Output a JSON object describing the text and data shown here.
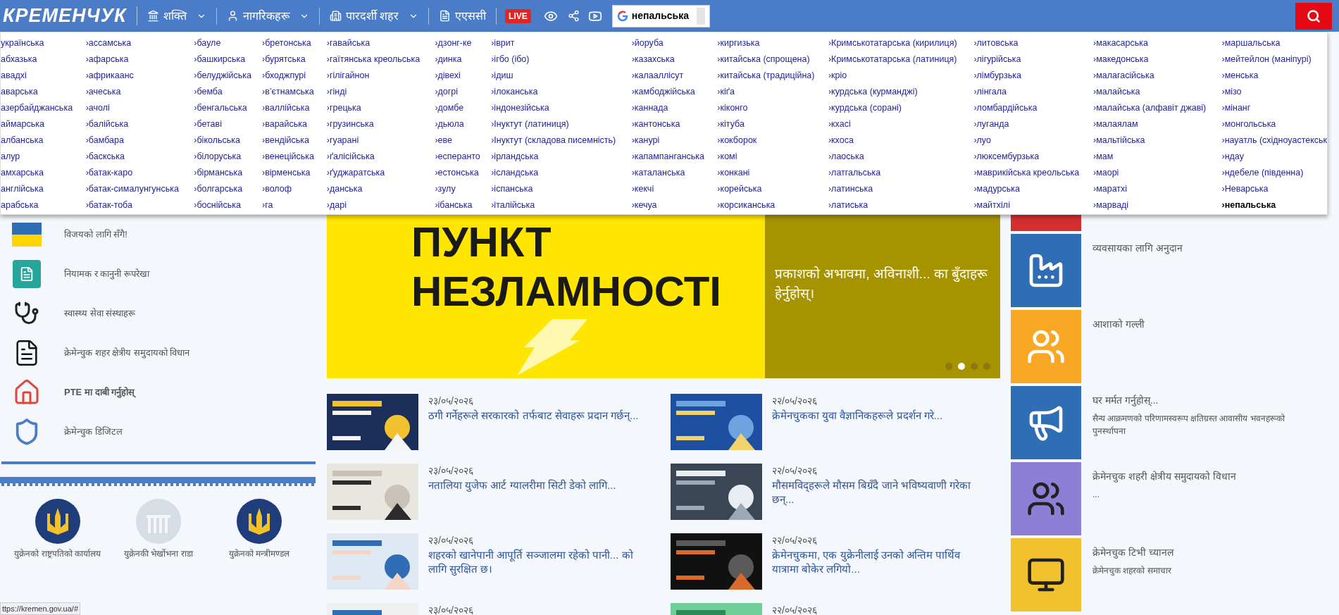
{
  "header": {
    "logo": "КРЕМЕНЧУК",
    "nav": [
      {
        "label": "शक्ति",
        "dropdown": true
      },
      {
        "label": "नागरिकहरू",
        "dropdown": true
      },
      {
        "label": "पारदर्शी शहर",
        "dropdown": true
      },
      {
        "label": "एएससी",
        "dropdown": false
      }
    ],
    "live_badge": "LIVE",
    "translate_value": "непальська"
  },
  "language_menu": {
    "columns": [
      [
        {
          "label": "українська",
          "selected": false
        },
        {
          "label": "абхазька",
          "selected": false
        },
        {
          "label": "авадхі",
          "selected": false
        },
        {
          "label": "аварська",
          "selected": false
        },
        {
          "label": "азербайджанська",
          "selected": false
        },
        {
          "label": "аймарська",
          "selected": false
        },
        {
          "label": "албанська",
          "selected": false
        },
        {
          "label": "алур",
          "selected": false
        },
        {
          "label": "амхарська",
          "selected": false
        },
        {
          "label": "англійська",
          "selected": false
        },
        {
          "label": "арабська",
          "selected": false
        }
      ],
      [
        {
          "label": "›ассамська",
          "selected": false
        },
        {
          "label": "›афарська",
          "selected": false
        },
        {
          "label": "›африкаанс",
          "selected": false
        },
        {
          "label": "›ачеська",
          "selected": false
        },
        {
          "label": "›ачолі",
          "selected": false
        },
        {
          "label": "›балійська",
          "selected": false
        },
        {
          "label": "›бамбара",
          "selected": false
        },
        {
          "label": "›баскська",
          "selected": false
        },
        {
          "label": "›батак-каро",
          "selected": false
        },
        {
          "label": "›батак-сималунгунська",
          "selected": false
        },
        {
          "label": "›батак-тоба",
          "selected": false
        }
      ],
      [
        {
          "label": "›бауле",
          "selected": false
        },
        {
          "label": "›башкирська",
          "selected": false
        },
        {
          "label": "›белуджійська",
          "selected": false
        },
        {
          "label": "›бемба",
          "selected": false
        },
        {
          "label": "›бенгальська",
          "selected": false
        },
        {
          "label": "›бетаві",
          "selected": false
        },
        {
          "label": "›бікольська",
          "selected": false
        },
        {
          "label": "›білоруська",
          "selected": false
        },
        {
          "label": "›бірманська",
          "selected": false
        },
        {
          "label": "›болгарська",
          "selected": false
        },
        {
          "label": "›боснійська",
          "selected": false
        }
      ],
      [
        {
          "label": "›бретонська",
          "selected": false
        },
        {
          "label": "›бурятська",
          "selected": false
        },
        {
          "label": "›бходжпурі",
          "selected": false
        },
        {
          "label": "›в’єтнамська",
          "selected": false
        },
        {
          "label": "›валлійська",
          "selected": false
        },
        {
          "label": "›варайська",
          "selected": false
        },
        {
          "label": "›вендійська",
          "selected": false
        },
        {
          "label": "›венеційська",
          "selected": false
        },
        {
          "label": "›вірменська",
          "selected": false
        },
        {
          "label": "›волоф",
          "selected": false
        },
        {
          "label": "›га",
          "selected": false
        }
      ],
      [
        {
          "label": "›гавайська",
          "selected": false
        },
        {
          "label": "›гаїтянська креольська",
          "selected": false
        },
        {
          "label": "›гілігайнон",
          "selected": false
        },
        {
          "label": "›гінді",
          "selected": false
        },
        {
          "label": "›грецька",
          "selected": false
        },
        {
          "label": "›грузинська",
          "selected": false
        },
        {
          "label": "›гуарані",
          "selected": false
        },
        {
          "label": "›ґалісійська",
          "selected": false
        },
        {
          "label": "›ґуджаратська",
          "selected": false
        },
        {
          "label": "›данська",
          "selected": false
        },
        {
          "label": "›дарі",
          "selected": false
        }
      ],
      [
        {
          "label": "›дзонг-ке",
          "selected": false
        },
        {
          "label": "›динка",
          "selected": false
        },
        {
          "label": "›дівехі",
          "selected": false
        },
        {
          "label": "›догрі",
          "selected": false
        },
        {
          "label": "›домбе",
          "selected": false
        },
        {
          "label": "›дьюла",
          "selected": false
        },
        {
          "label": "›еве",
          "selected": false
        },
        {
          "label": "›есперанто",
          "selected": false
        },
        {
          "label": "›естонська",
          "selected": false
        },
        {
          "label": "›зулу",
          "selected": false
        },
        {
          "label": "›ібанська",
          "selected": false
        }
      ],
      [
        {
          "label": "›іврит",
          "selected": false
        },
        {
          "label": "›ігбо (ібо)",
          "selected": false
        },
        {
          "label": "›ідиш",
          "selected": false
        },
        {
          "label": "›ілоканська",
          "selected": false
        },
        {
          "label": "›індонезійська",
          "selected": false
        },
        {
          "label": "›Інуктут (латиниця)",
          "selected": false
        },
        {
          "label": "›Інуктут (складова писемність)",
          "selected": false
        },
        {
          "label": "›ірландська",
          "selected": false
        },
        {
          "label": "›ісландська",
          "selected": false
        },
        {
          "label": "›іспанська",
          "selected": false
        },
        {
          "label": "›італійська",
          "selected": false
        }
      ],
      [
        {
          "label": "›йоруба",
          "selected": false
        },
        {
          "label": "›казахська",
          "selected": false
        },
        {
          "label": "›калааллісут",
          "selected": false
        },
        {
          "label": "›камбоджійська",
          "selected": false
        },
        {
          "label": "›каннада",
          "selected": false
        },
        {
          "label": "›кантонська",
          "selected": false
        },
        {
          "label": "›канурі",
          "selected": false
        },
        {
          "label": "›капампанганська",
          "selected": false
        },
        {
          "label": "›каталанська",
          "selected": false
        },
        {
          "label": "›кекчі",
          "selected": false
        },
        {
          "label": "›кечуа",
          "selected": false
        }
      ],
      [
        {
          "label": "›киргизька",
          "selected": false
        },
        {
          "label": "›китайська (спрощена)",
          "selected": false
        },
        {
          "label": "›китайська (традиційна)",
          "selected": false
        },
        {
          "label": "›кіґа",
          "selected": false
        },
        {
          "label": "›кіконго",
          "selected": false
        },
        {
          "label": "›кітуба",
          "selected": false
        },
        {
          "label": "›кокборок",
          "selected": false
        },
        {
          "label": "›комі",
          "selected": false
        },
        {
          "label": "›конкані",
          "selected": false
        },
        {
          "label": "›корейська",
          "selected": false
        },
        {
          "label": "›корсиканська",
          "selected": false
        }
      ],
      [
        {
          "label": "›Кримськотатарська (кирилиця)",
          "selected": false
        },
        {
          "label": "›Кримськотатарська (латиниця)",
          "selected": false
        },
        {
          "label": "›кріо",
          "selected": false
        },
        {
          "label": "›курдська (курманджі)",
          "selected": false
        },
        {
          "label": "›курдська (сорані)",
          "selected": false
        },
        {
          "label": "›кхасі",
          "selected": false
        },
        {
          "label": "›кхоса",
          "selected": false
        },
        {
          "label": "›лаоська",
          "selected": false
        },
        {
          "label": "›латгальська",
          "selected": false
        },
        {
          "label": "›латинська",
          "selected": false
        },
        {
          "label": "›латиська",
          "selected": false
        }
      ],
      [
        {
          "label": "›литовська",
          "selected": false
        },
        {
          "label": "›лігурійська",
          "selected": false
        },
        {
          "label": "›лімбурзька",
          "selected": false
        },
        {
          "label": "›лінгала",
          "selected": false
        },
        {
          "label": "›ломбардійська",
          "selected": false
        },
        {
          "label": "›луганда",
          "selected": false
        },
        {
          "label": "›луо",
          "selected": false
        },
        {
          "label": "›люксембурзька",
          "selected": false
        },
        {
          "label": "›маврикійська креольська",
          "selected": false
        },
        {
          "label": "›мадурська",
          "selected": false
        },
        {
          "label": "›майтхілі",
          "selected": false
        }
      ],
      [
        {
          "label": "›макасарська",
          "selected": false
        },
        {
          "label": "›македонська",
          "selected": false
        },
        {
          "label": "›малагасійська",
          "selected": false
        },
        {
          "label": "›малайська",
          "selected": false
        },
        {
          "label": "›малайська (алфавіт джаві)",
          "selected": false
        },
        {
          "label": "›малаялам",
          "selected": false
        },
        {
          "label": "›мальтійська",
          "selected": false
        },
        {
          "label": "›мам",
          "selected": false
        },
        {
          "label": "›маорі",
          "selected": false
        },
        {
          "label": "›маратхі",
          "selected": false
        },
        {
          "label": "›марваді",
          "selected": false
        }
      ],
      [
        {
          "label": "›маршальська",
          "selected": false
        },
        {
          "label": "›мейтейлон (маніпурі)",
          "selected": false
        },
        {
          "label": "›менська",
          "selected": false
        },
        {
          "label": "›мізо",
          "selected": false
        },
        {
          "label": "›мінанг",
          "selected": false
        },
        {
          "label": "›монгольська",
          "selected": false
        },
        {
          "label": "›науатль (східноуастекськ",
          "selected": false
        },
        {
          "label": "›ндау",
          "selected": false
        },
        {
          "label": "›ндебеле (південна)",
          "selected": false
        },
        {
          "label": "›Неварська",
          "selected": false
        },
        {
          "label": "›непальська",
          "selected": true
        }
      ]
    ]
  },
  "sidebar": {
    "items": [
      {
        "label": "विजयको लागि सँगै!"
      },
      {
        "label": "नियामक र कानुनी रूपरेखा"
      },
      {
        "label": "स्वास्थ्य सेवा संस्थाहरू"
      },
      {
        "label": "क्रेमेन्चुक शहर क्षेत्रीय समुदायको विधान"
      },
      {
        "label": "PTE मा दाबी गर्नुहोस्"
      },
      {
        "label": "क्रेमेन्चुक डिजिटल"
      }
    ],
    "government_links": [
      {
        "label": "युक्रेनको राष्ट्रपतिको कार्यालय"
      },
      {
        "label": "युक्रेनकी भेर्खोभना राडा"
      },
      {
        "label": "युक्रेनको मन्त्रीमण्डल"
      }
    ]
  },
  "banner": {
    "heading_lines": [
      "ПУНКТ",
      "НЕЗЛАМНОСТІ"
    ],
    "caption": "प्रकाशको अभावमा, अविनाशी... का बुँदाहरू हेर्नुहोस्।",
    "dots": [
      {
        "selected": false
      },
      {
        "selected": true
      },
      {
        "selected": false
      },
      {
        "selected": false
      }
    ]
  },
  "news": [
    {
      "date": "२३/०५/२०२६",
      "title": "ठगी गर्नेहरूले सरकारको तर्फबाट सेवाहरू प्रदान गर्छन्..."
    },
    {
      "date": "२२/०५/२०२६",
      "title": "क्रेमेनचुकका युवा वैज्ञानिकहरूले प्रदर्शन गरे..."
    },
    {
      "date": "२३/०५/२०२६",
      "title": "नतालिया युजेफ आर्ट ग्यालरीमा सिटी डेको लागि..."
    },
    {
      "date": "२२/०५/२०२६",
      "title": "मौसमविद्हरूले मौसम बिग्रँदै जाने भविष्यवाणी गरेका छन्..."
    },
    {
      "date": "२३/०५/२०२६",
      "title": "शहरको खानेपानी आपूर्ति सञ्जालमा रहेको पानी... को लागि सुरक्षित छ।"
    },
    {
      "date": "२२/०५/२०२६",
      "title": "क्रेमेनचुकमा, एक युक्रेनीलाई उनको अन्तिम पार्थिव यात्रामा बोकेर लगियो..."
    },
    {
      "date": "२३/०५/२०२६"
    },
    {
      "date": "२२/०५/२०२६"
    }
  ],
  "tiles": [
    {
      "color": "#d32f2f"
    },
    {
      "color": "#2f6db5",
      "title": "व्यवसायका लागि अनुदान"
    },
    {
      "color": "#f9a825",
      "title": "आशाको गल्ली"
    },
    {
      "color": "#2f6db5",
      "title": "घर मर्मत गर्नुहोस्...",
      "subtitle": "सैन्य आक्रमणको परिणामस्वरूप क्षतिग्रस्त आवासीय भवनहरूको पुनर्स्थापना"
    },
    {
      "color": "#8e7fd6",
      "title": "क्रेमेनचुक शहरी क्षेत्रीय समुदायको विधान",
      "subtitle": "..."
    },
    {
      "color": "#f2c12e",
      "title": "क्रेमेनचुक टिभी च्यानल",
      "subtitle": "क्रेमेनचुक शहरको समाचार"
    }
  ],
  "status_url": "ttps://kremen.gov.ua/#"
}
